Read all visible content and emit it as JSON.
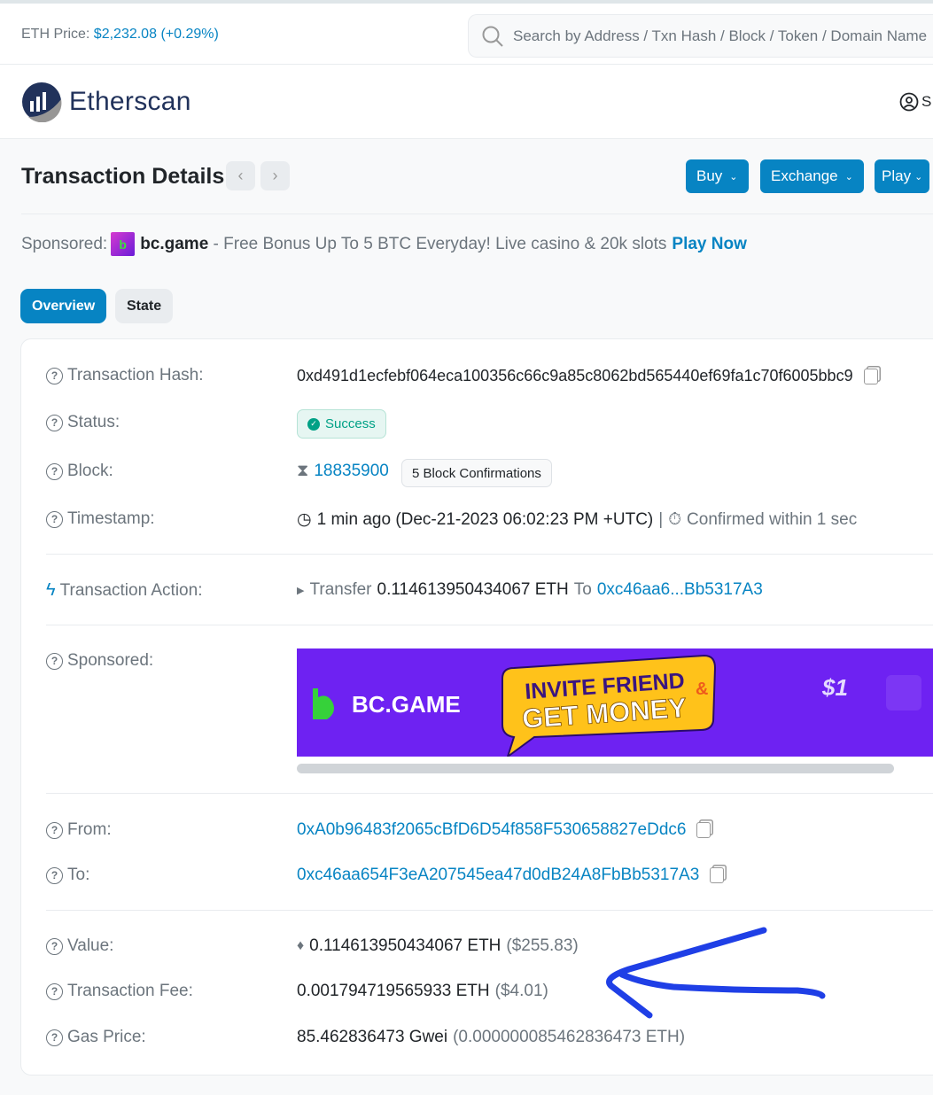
{
  "topbar": {
    "eth_price_label": "ETH Price:",
    "eth_price_value": "$2,232.08",
    "eth_price_change": "(+0.29%)",
    "search_placeholder": "Search by Address / Txn Hash / Block / Token / Domain Name"
  },
  "header": {
    "brand": "Etherscan",
    "user_label": "S"
  },
  "page": {
    "title": "Transaction Details",
    "buttons": [
      "Buy",
      "Exchange",
      "Play"
    ]
  },
  "sponsored_line": {
    "label": "Sponsored:",
    "brand": "bc.game",
    "text": " - Free Bonus Up To 5 BTC Everyday! Live casino & 20k slots",
    "cta": "Play Now"
  },
  "tabs": [
    {
      "label": "Overview",
      "active": true
    },
    {
      "label": "State",
      "active": false
    }
  ],
  "details": {
    "hash_label": "Transaction Hash:",
    "hash": "0xd491d1ecfebf064eca100356c66c9a85c8062bd565440ef69fa1c70f6005bbc9",
    "status_label": "Status:",
    "status": "Success",
    "block_label": "Block:",
    "block": "18835900",
    "confirmations": "5 Block Confirmations",
    "timestamp_label": "Timestamp:",
    "timestamp": "1 min ago (Dec-21-2023 06:02:23 PM +UTC)",
    "confirmed": "Confirmed within 1 sec",
    "action_label": "Transaction Action:",
    "action_verb": "Transfer",
    "action_amount": "0.114613950434067 ETH",
    "action_to": "To",
    "action_addr": "0xc46aa6...Bb5317A3",
    "sponsored_label": "Sponsored:",
    "banner_brand": "BC.GAME",
    "banner_line1": "INVITE FRIEND",
    "banner_amp": "&",
    "banner_line2": "GET MONEY",
    "banner_dollar": "$1",
    "from_label": "From:",
    "from": "0xA0b96483f2065cBfD6D54f858F530658827eDdc6",
    "to_label": "To:",
    "to": "0xc46aa654F3eA207545ea47d0dB24A8FbBb5317A3",
    "value_label": "Value:",
    "value": "0.114613950434067 ETH",
    "value_usd": "($255.83)",
    "fee_label": "Transaction Fee:",
    "fee": "0.001794719565933 ETH",
    "fee_usd": "($4.01)",
    "gas_label": "Gas Price:",
    "gas": "85.462836473 Gwei",
    "gas_eth": "(0.000000085462836473 ETH)"
  },
  "colors": {
    "accent": "#0784c3",
    "success": "#00a186",
    "annotation": "#1f3fe6",
    "banner": "#6e22f2"
  }
}
